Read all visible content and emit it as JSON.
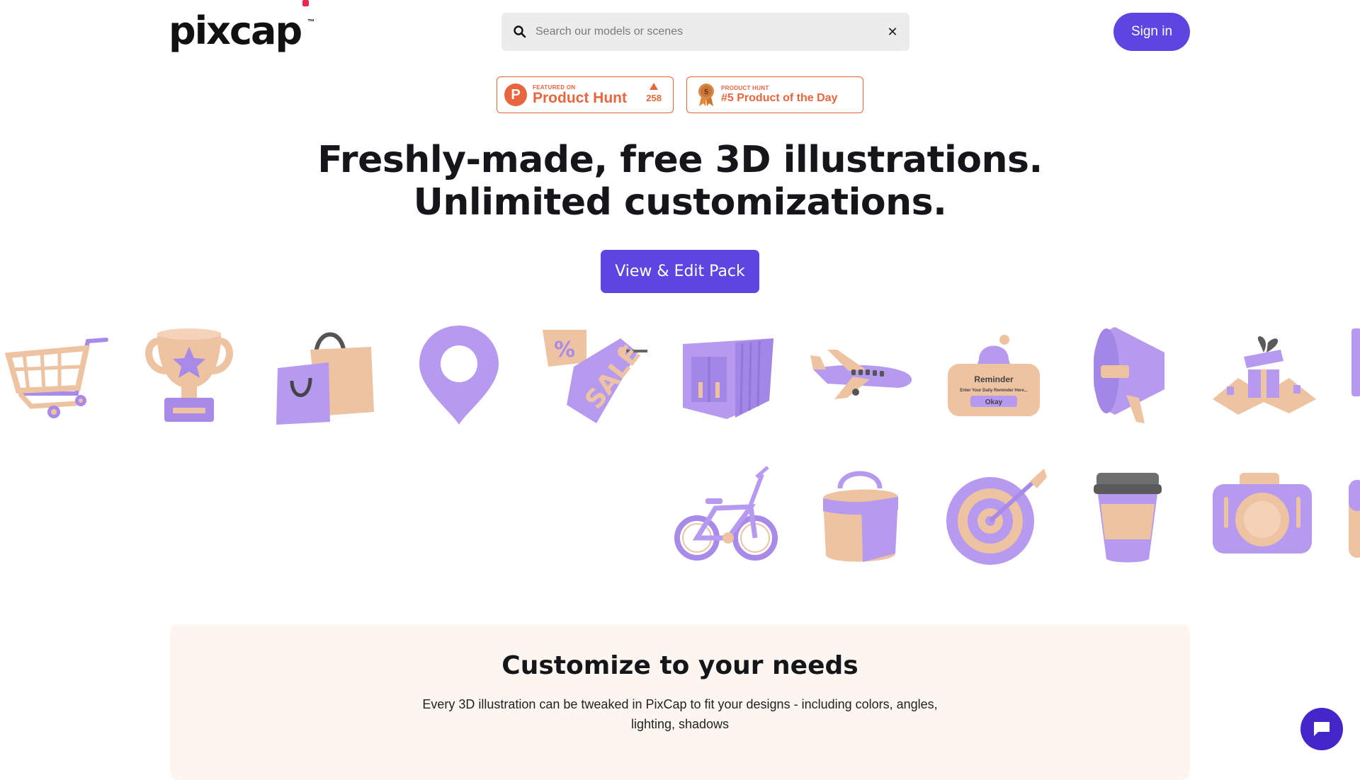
{
  "header": {
    "logo_text": "pixcap",
    "logo_tm": "™",
    "search_placeholder": "Search our models or scenes",
    "clear_symbol": "✕",
    "signin_label": "Sign in"
  },
  "badges": {
    "product_hunt": {
      "small": "FEATURED ON",
      "big": "Product Hunt",
      "votes": "258",
      "logo_letter": "P"
    },
    "product_of_day": {
      "small": "PRODUCT HUNT",
      "big": "#5 Product of the Day",
      "medal_number": "5"
    }
  },
  "hero": {
    "line1": "Freshly-made, free 3D illustrations.",
    "line2": "Unlimited customizations.",
    "cta_label": "View & Edit Pack"
  },
  "illustrations": {
    "reminder_title": "Reminder",
    "reminder_sub": "Enter Your Daily Reminder Here...",
    "reminder_button": "Okay",
    "sale_text": "SALE"
  },
  "section": {
    "title": "Customize to your needs",
    "body": "Every 3D illustration can be tweaked in PixCap to fit your designs - including colors, angles, lighting, shadows"
  },
  "colors": {
    "accent": "#5e44e0",
    "product_hunt": "#e9653e",
    "peach": "#f0c4a6",
    "lavender": "#b69af0",
    "section_bg": "#fdf5ef"
  }
}
